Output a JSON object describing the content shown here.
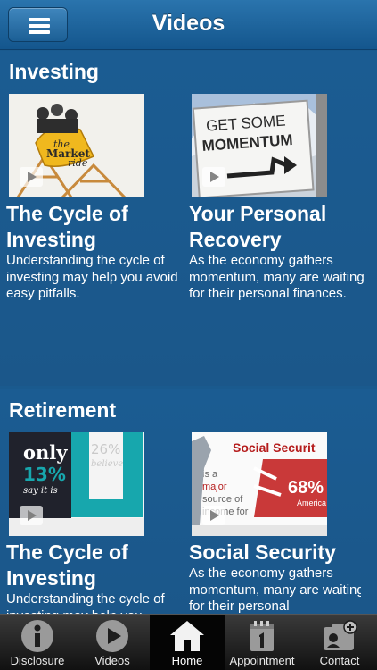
{
  "header": {
    "title": "Videos"
  },
  "sections": [
    {
      "title": "Investing",
      "cards": [
        {
          "thumb_text": [
            "the",
            "Market",
            "ride"
          ],
          "title": "The Cycle of Investing",
          "desc": "Understanding the cycle of investing may help you avoid easy pitfalls."
        },
        {
          "thumb_text": [
            "GET SOME",
            "MOMENTUM"
          ],
          "title": "Your Personal Recovery",
          "desc": "As the economy gathers momentum, many are waiting for their personal finances."
        }
      ]
    },
    {
      "title": "Retirement",
      "cards": [
        {
          "thumb_text": [
            "only",
            "13%",
            "say it is",
            "26%",
            "believe"
          ],
          "title": "The Cycle of Investing",
          "desc": "Understanding the cycle of investing may help you"
        },
        {
          "thumb_text": [
            "Social Securit",
            "is a",
            "major",
            "source of",
            "income for",
            "68%",
            "America"
          ],
          "title": "Social Security",
          "desc": "As the economy gathers momentum, many are waiting for their personal"
        }
      ]
    }
  ],
  "tabs": [
    {
      "label": "Disclosure",
      "icon": "info-icon"
    },
    {
      "label": "Videos",
      "icon": "play-icon"
    },
    {
      "label": "Home",
      "icon": "home-icon",
      "active": true
    },
    {
      "label": "Appointment",
      "icon": "calendar-icon"
    },
    {
      "label": "Contact",
      "icon": "contact-card-icon"
    }
  ],
  "colors": {
    "header": "#14568d",
    "background": "#1b5a8e",
    "tabbar": "#1a1a1a"
  }
}
